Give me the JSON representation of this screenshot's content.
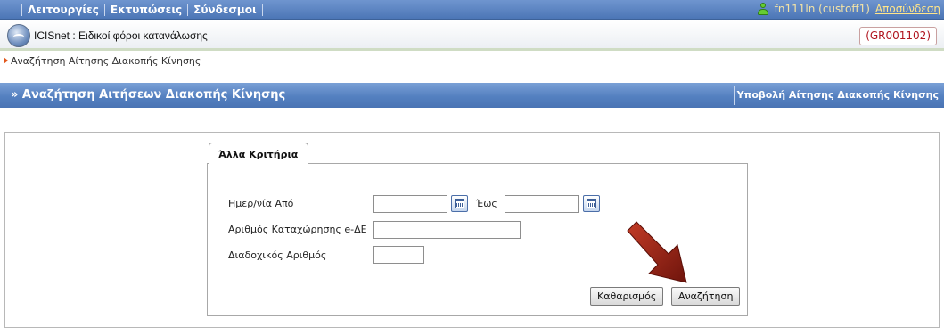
{
  "menu": {
    "items": [
      {
        "label": "Λειτουργίες"
      },
      {
        "label": "Εκτυπώσεις"
      },
      {
        "label": "Σύνδεσμοι"
      }
    ],
    "user_text": "fn111ln (custoff1)",
    "logout_label": "Αποσύνδεση"
  },
  "app": {
    "title": "ICISnet : Ειδικοί φόροι κατανάλωσης",
    "code": "(GR001102)"
  },
  "breadcrumb": {
    "text": "Αναζήτηση Αίτησης Διακοπής Κίνησης"
  },
  "section": {
    "title": "» Αναζήτηση Αιτήσεων Διακοπής Κίνησης",
    "link_label": "Υποβολή Αίτησης Διακοπής Κίνησης"
  },
  "form": {
    "tab_label": "Άλλα Κριτήρια",
    "date_from_label": "Ημερ/νία Από",
    "date_from_value": "",
    "date_to_label": "Έως",
    "date_to_value": "",
    "registration_label": "Αριθμός Καταχώρησης e-ΔΕ",
    "registration_value": "",
    "serial_label": "Διαδοχικός Αριθμός",
    "serial_value": "",
    "clear_label": "Καθαρισμός",
    "search_label": "Αναζήτηση"
  },
  "colors": {
    "menu_bar": "#5a80be",
    "section_bar": "#5480c0",
    "app_code": "#b0141e",
    "annotation_arrow": "#8b1c12"
  },
  "icons": [
    "user-icon",
    "app-logo-icon",
    "breadcrumb-arrow-icon",
    "calendar-icon",
    "annotation-arrow-icon"
  ]
}
